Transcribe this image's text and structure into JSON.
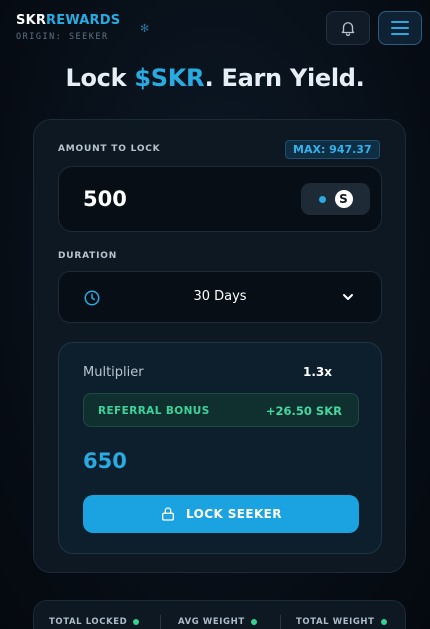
{
  "brand": {
    "title_white": "SKR",
    "title_blue": "REWARDS",
    "subtitle": "ORIGIN: SEEKER"
  },
  "headline": {
    "part1": "Lock ",
    "accent": "$SKR",
    "part2": ". Earn Yield."
  },
  "lock_form": {
    "amount_label": "AMOUNT TO LOCK",
    "max_label": "MAX: 947.37",
    "amount_value": "500",
    "token_symbol": "S",
    "duration_label": "DURATION",
    "duration_value": "30 Days"
  },
  "summary": {
    "multiplier_label": "Multiplier",
    "multiplier_value": "1.3x",
    "bonus_label": "REFERRAL BONUS",
    "bonus_value": "+26.50 SKR",
    "total_value": "650",
    "lock_button_label": "LOCK SEEKER"
  },
  "stats": [
    {
      "label": "TOTAL LOCKED"
    },
    {
      "label": "AVG WEIGHT"
    },
    {
      "label": "TOTAL WEIGHT"
    }
  ],
  "colors": {
    "accent": "#29abe2",
    "success": "#3ed39a",
    "background": "#070d15"
  },
  "icons": {
    "bell": "bell-icon",
    "menu": "menu-icon",
    "clock": "clock-icon",
    "chevron": "chevron-down-icon",
    "lock": "lock-icon",
    "sparkle": "sparkle-icon"
  }
}
